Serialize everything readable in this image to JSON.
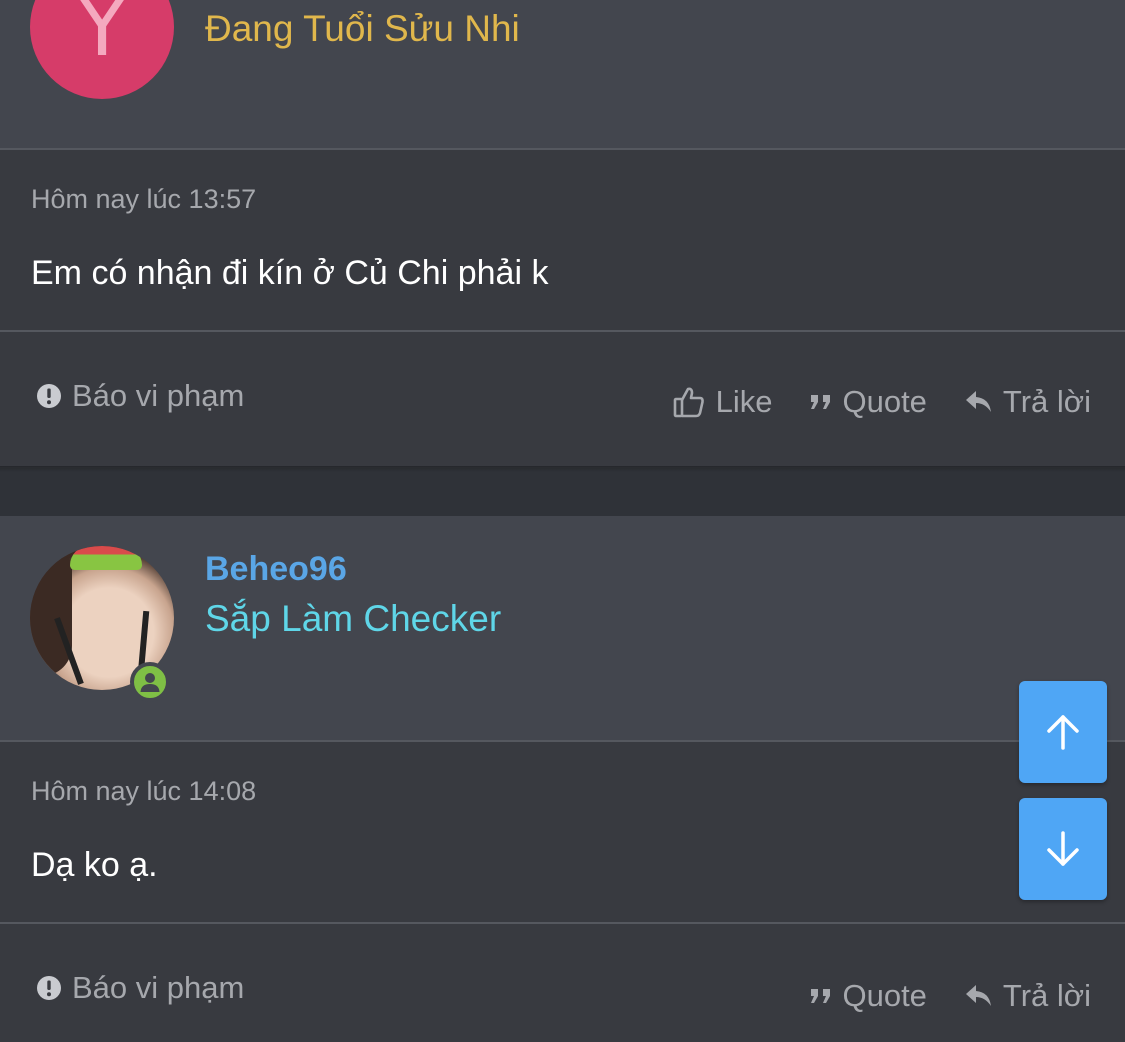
{
  "posts": [
    {
      "avatar_letter": "Y",
      "user_title": "Đang Tuổi Sửu Nhi",
      "timestamp": "Hôm nay lúc 13:57",
      "message": "Em có nhận đi kín ở Củ Chi phải k",
      "report_label": "Báo vi phạm",
      "like_label": "Like",
      "quote_label": "Quote",
      "reply_label": "Trả lời"
    },
    {
      "username": "Beheo96",
      "user_title": "Sắp Làm Checker",
      "timestamp": "Hôm nay lúc 14:08",
      "message": "Dạ ko ạ.",
      "report_label": "Báo vi phạm",
      "quote_label": "Quote",
      "reply_label": "Trả lời"
    }
  ],
  "colors": {
    "avatar_bg": "#d63c69",
    "title_gold": "#e0b74c",
    "username_blue": "#5aa6e6",
    "title_cyan": "#5fd6e8",
    "online_green": "#7fbf45",
    "scroll_button": "#4fa6f5"
  },
  "icons": {
    "report": "exclamation-circle-icon",
    "like": "thumbs-up-icon",
    "quote": "quote-icon",
    "reply": "reply-icon",
    "scroll_up": "arrow-up-icon",
    "scroll_down": "arrow-down-icon",
    "online": "user-icon"
  }
}
